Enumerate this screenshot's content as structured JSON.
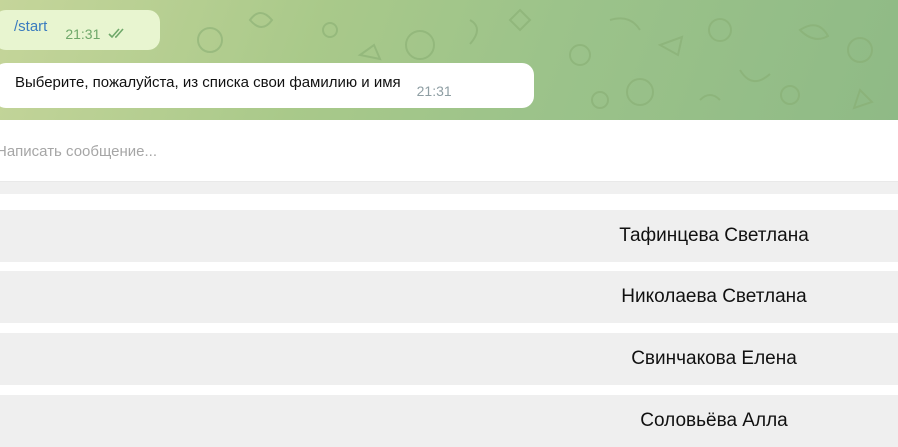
{
  "messages": {
    "outgoing": {
      "text": "/start",
      "time": "21:31",
      "status_icon": "double-check-icon"
    },
    "incoming": {
      "text": "Выберите, пожалуйста, из списка свои фамилию и имя",
      "time": "21:31"
    }
  },
  "composer": {
    "placeholder": "Написать сообщение..."
  },
  "keyboard": {
    "buttons": [
      {
        "label": "Тафинцева Светлана"
      },
      {
        "label": "Николаева Светлана"
      },
      {
        "label": "Свинчакова Елена"
      },
      {
        "label": "Соловьёва Алла"
      }
    ]
  },
  "colors": {
    "chat_background": "#9cc38a",
    "outgoing_bubble": "#e8f5d0",
    "incoming_bubble": "#ffffff",
    "keyboard_button": "#efefef",
    "link": "#3a7bbf"
  }
}
